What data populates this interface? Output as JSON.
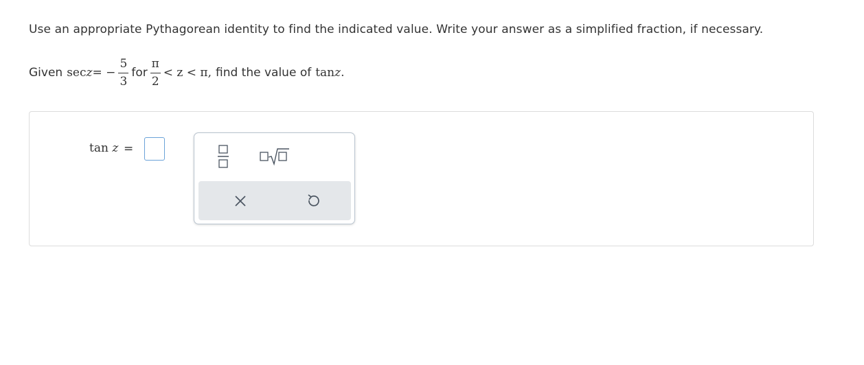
{
  "instruction": "Use an appropriate Pythagorean identity to find the indicated value. Write your answer as a simplified fraction, if necessary.",
  "question": {
    "given_word": "Given",
    "sec_fn": "sec",
    "variable": "z",
    "equals_neg": "= −",
    "sec_numerator": "5",
    "sec_denominator": "3",
    "for_word": "for",
    "bound_numerator": "π",
    "bound_denominator": "2",
    "inequality": "< z < π,",
    "find_text": "find the value of",
    "tan_fn": "tan",
    "period": "."
  },
  "answer": {
    "tan_fn": "tan",
    "variable": "z",
    "equals": "=",
    "value": ""
  },
  "palette": {
    "tools": [
      "fraction-icon",
      "square-root-icon"
    ],
    "actions": [
      "clear-icon",
      "undo-icon"
    ]
  },
  "colors": {
    "answer_box_border": "#6aa2d8",
    "palette_border": "#b9c4cf",
    "action_row_bg": "#e4e7ea",
    "icon_color": "#4a5460"
  }
}
